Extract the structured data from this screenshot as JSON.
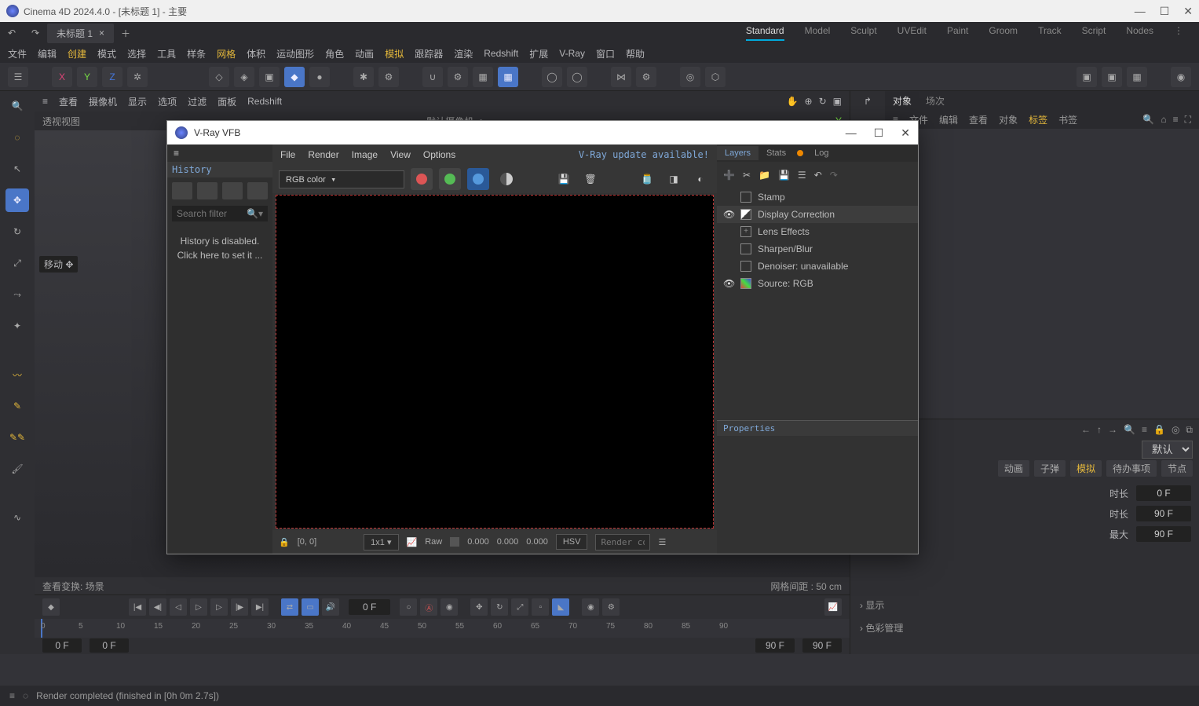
{
  "titlebar": {
    "text": "Cinema 4D 2024.4.0 - [未标题 1] - 主要"
  },
  "doctab": {
    "name": "未标题 1"
  },
  "layouts": [
    "Standard",
    "Model",
    "Sculpt",
    "UVEdit",
    "Paint",
    "Groom",
    "Track",
    "Script",
    "Nodes"
  ],
  "layout_active": 0,
  "menus": {
    "items": [
      "文件",
      "编辑",
      "创建",
      "模式",
      "选择",
      "工具",
      "样条",
      "网格",
      "体积",
      "运动图形",
      "角色",
      "动画",
      "模拟",
      "跟踪器",
      "渲染",
      "Redshift",
      "扩展",
      "V-Ray",
      "窗口",
      "帮助"
    ],
    "hl": [
      2,
      7,
      12
    ]
  },
  "axes": [
    "X",
    "Y",
    "Z"
  ],
  "vpmenu": [
    "≡",
    "查看",
    "摄像机",
    "显示",
    "选项",
    "过滤",
    "面板",
    "Redshift"
  ],
  "vpname": "透视视图",
  "vpcam": "默认摄像机",
  "tooltip": "移动 ✥",
  "vpfoot": {
    "left": "查看变换:  场景",
    "right": "网格间距 : 50 cm"
  },
  "objtabs": {
    "items": [
      "对象",
      "场次"
    ],
    "active": 0
  },
  "objmenu": {
    "items": [
      "≡",
      "文件",
      "编辑",
      "查看",
      "对象",
      "标签",
      "书签"
    ],
    "hl": 5
  },
  "attr": {
    "mode": "默认",
    "tabs": [
      "动画",
      "子弹",
      "模拟",
      "待办事项",
      "节点"
    ],
    "tabs_hl": 2,
    "fields": [
      {
        "label": "时长",
        "value": "0 F"
      },
      {
        "label": "时长",
        "value": "90 F"
      },
      {
        "label": "最大",
        "value": "90 F"
      }
    ],
    "sections": [
      "显示",
      "色彩管理"
    ]
  },
  "timeline": {
    "frame": "0 F",
    "ticks": [
      "0",
      "5",
      "10",
      "15",
      "20",
      "25",
      "30",
      "35",
      "40",
      "45",
      "50",
      "55",
      "60",
      "65",
      "70",
      "75",
      "80",
      "85",
      "90"
    ],
    "f1": "0 F",
    "f2": "0 F",
    "f3": "90 F",
    "f4": "90 F"
  },
  "status": "Render completed (finished in [0h  0m  2.7s])",
  "vfb": {
    "title": "V-Ray VFB",
    "history_title": "History",
    "search_ph": "Search filter",
    "history_msg1": "History is disabled.",
    "history_msg2": "Click here to set it ...",
    "menus": [
      "File",
      "Render",
      "Image",
      "View",
      "Options"
    ],
    "update": "V-Ray update available!",
    "channel": "RGB color",
    "coords": "[0, 0]",
    "zoom": "1x1",
    "raw": "Raw",
    "v1": "0.000",
    "v2": "0.000",
    "v3": "0.000",
    "hsv": "HSV",
    "render_ph": "Render co",
    "ltabs": [
      "Layers",
      "Stats",
      "Log"
    ],
    "layers": [
      {
        "name": "Stamp",
        "eye": false,
        "box": ""
      },
      {
        "name": "Display Correction",
        "eye": true,
        "box": "check"
      },
      {
        "name": "Lens Effects",
        "eye": false,
        "box": "plus"
      },
      {
        "name": "Sharpen/Blur",
        "eye": false,
        "box": ""
      },
      {
        "name": "Denoiser: unavailable",
        "eye": false,
        "box": ""
      },
      {
        "name": "Source: RGB",
        "eye": true,
        "box": "rgb"
      }
    ],
    "props_title": "Properties"
  }
}
